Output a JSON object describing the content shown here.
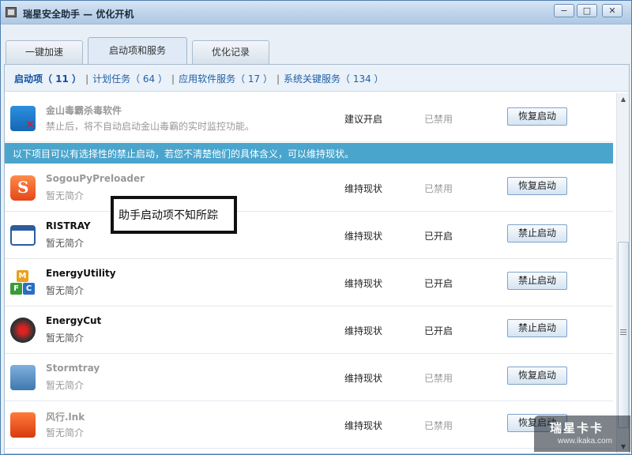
{
  "window": {
    "title": "瑞星安全助手 — 优化开机",
    "controls": {
      "minimize": "−",
      "maximize": "□",
      "close": "✕"
    }
  },
  "tabs": [
    {
      "label": "一键加速",
      "active": false
    },
    {
      "label": "启动项和服务",
      "active": true
    },
    {
      "label": "优化记录",
      "active": false
    }
  ],
  "filters": [
    {
      "label": "启动项（ 11 ）",
      "active": true
    },
    {
      "label": "计划任务（ 64 ）",
      "active": false
    },
    {
      "label": "应用软件服务（ 17 ）",
      "active": false
    },
    {
      "label": "系统关键服务（ 134 ）",
      "active": false
    }
  ],
  "filter_separator": "|",
  "banner": "以下项目可以有选择性的禁止启动，若您不清楚他们的具体含义，可以维持现状。",
  "items": [
    {
      "name": "金山毒霸杀毒软件",
      "desc": "禁止后，将不自动启动金山毒霸的实时监控功能。",
      "suggest": "建议开启",
      "state": "已禁用",
      "button": "恢复启动",
      "icon": "kingsoft-antivirus-icon"
    },
    {
      "name": "SogouPyPreloader",
      "desc": "暂无简介",
      "suggest": "维持现状",
      "state": "已禁用",
      "button": "恢复启动",
      "icon": "sogou-icon"
    },
    {
      "name": "RISTRAY",
      "desc": "暂无简介",
      "suggest": "维持现状",
      "state": "已开启",
      "button": "禁止启动",
      "icon": "window-icon"
    },
    {
      "name": "EnergyUtility",
      "desc": "暂无简介",
      "suggest": "维持现状",
      "state": "已开启",
      "button": "禁止启动",
      "icon": "energy-utility-icon",
      "blocks": [
        "M",
        "F",
        "C"
      ]
    },
    {
      "name": "EnergyCut",
      "desc": "暂无简介",
      "suggest": "维持现状",
      "state": "已开启",
      "button": "禁止启动",
      "icon": "energycut-icon"
    },
    {
      "name": "Stormtray",
      "desc": "暂无简介",
      "suggest": "维持现状",
      "state": "已禁用",
      "button": "恢复启动",
      "icon": "stormtray-icon"
    },
    {
      "name": "风行.lnk",
      "desc": "暂无简介",
      "suggest": "维持现状",
      "state": "已禁用",
      "button": "恢复启动",
      "icon": "fengxing-icon"
    }
  ],
  "annotation": "助手启动项不知所踪",
  "watermark": {
    "title": "瑞星卡卡",
    "url": "www.ikaka.com"
  },
  "colors": {
    "banner": "#4aa5cd",
    "link": "#2060a8"
  }
}
